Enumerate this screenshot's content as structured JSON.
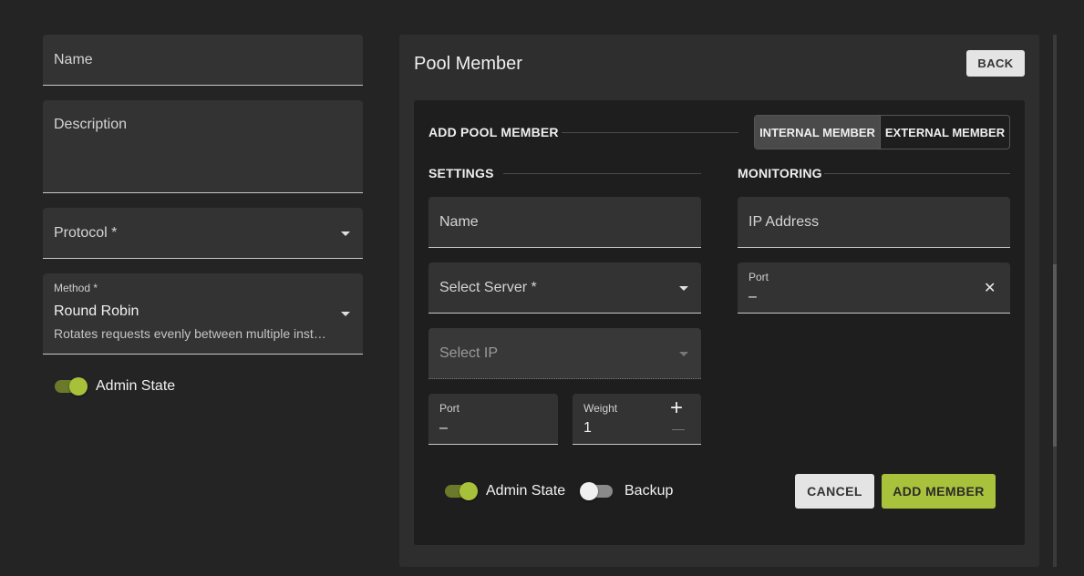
{
  "left_form": {
    "name_placeholder": "Name",
    "description_placeholder": "Description",
    "protocol_placeholder": "Protocol *",
    "method_label": "Method *",
    "method_value": "Round Robin",
    "method_helper": "Rotates requests evenly between multiple inst…",
    "admin_state_label": "Admin State"
  },
  "panel": {
    "title": "Pool Member",
    "back_label": "BACK",
    "add_pool_member_title": "ADD POOL MEMBER",
    "tabs": [
      {
        "label": "INTERNAL MEMBER",
        "active": true
      },
      {
        "label": "EXTERNAL MEMBER",
        "active": false
      }
    ],
    "settings_title": "SETTINGS",
    "monitoring_title": "MONITORING",
    "settings": {
      "name_placeholder": "Name",
      "select_server_placeholder": "Select Server *",
      "select_ip_placeholder": "Select IP",
      "port_label": "Port",
      "port_value": "–",
      "weight_label": "Weight",
      "weight_value": "1",
      "weight_increment": "+",
      "weight_decrement": "—"
    },
    "monitoring": {
      "ip_address_placeholder": "IP Address",
      "port_label": "Port",
      "port_value": "–",
      "clear_glyph": "✕"
    },
    "admin_state_label": "Admin State",
    "backup_label": "Backup",
    "cancel_label": "CANCEL",
    "add_member_label": "ADD MEMBER"
  },
  "colors": {
    "accent": "#a9c23c",
    "background": "#242424",
    "panel": "#2e2e2e",
    "inner_panel": "#1e1e1e"
  }
}
